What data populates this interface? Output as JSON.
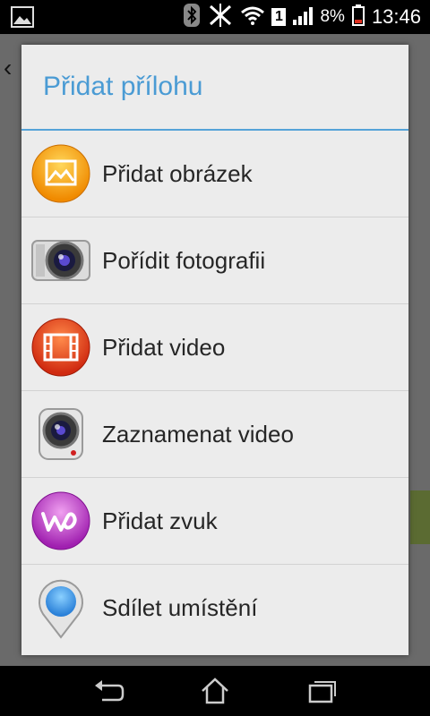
{
  "status_bar": {
    "battery_percent": "8%",
    "time": "13:46",
    "sim_slot": "1",
    "icons": [
      "image-notification-icon",
      "bluetooth-icon",
      "nfc-icon",
      "wifi-icon",
      "sim-icon",
      "signal-icon",
      "battery-icon"
    ]
  },
  "dialog": {
    "title": "Přidat přílohu",
    "items": [
      {
        "label": "Přidat obrázek",
        "icon": "gallery-icon"
      },
      {
        "label": "Pořídit fotografii",
        "icon": "camera-icon"
      },
      {
        "label": "Přidat video",
        "icon": "video-icon"
      },
      {
        "label": "Zaznamenat video",
        "icon": "camcorder-icon"
      },
      {
        "label": "Přidat zvuk",
        "icon": "walkman-icon"
      },
      {
        "label": "Sdílet umístění",
        "icon": "location-pin-icon"
      }
    ]
  },
  "nav_bar": {
    "buttons": [
      "back-icon",
      "home-icon",
      "recent-apps-icon"
    ]
  },
  "colors": {
    "title": "#4a9bd4",
    "divider": "#55a3d8",
    "dialog_bg": "#ececec"
  }
}
